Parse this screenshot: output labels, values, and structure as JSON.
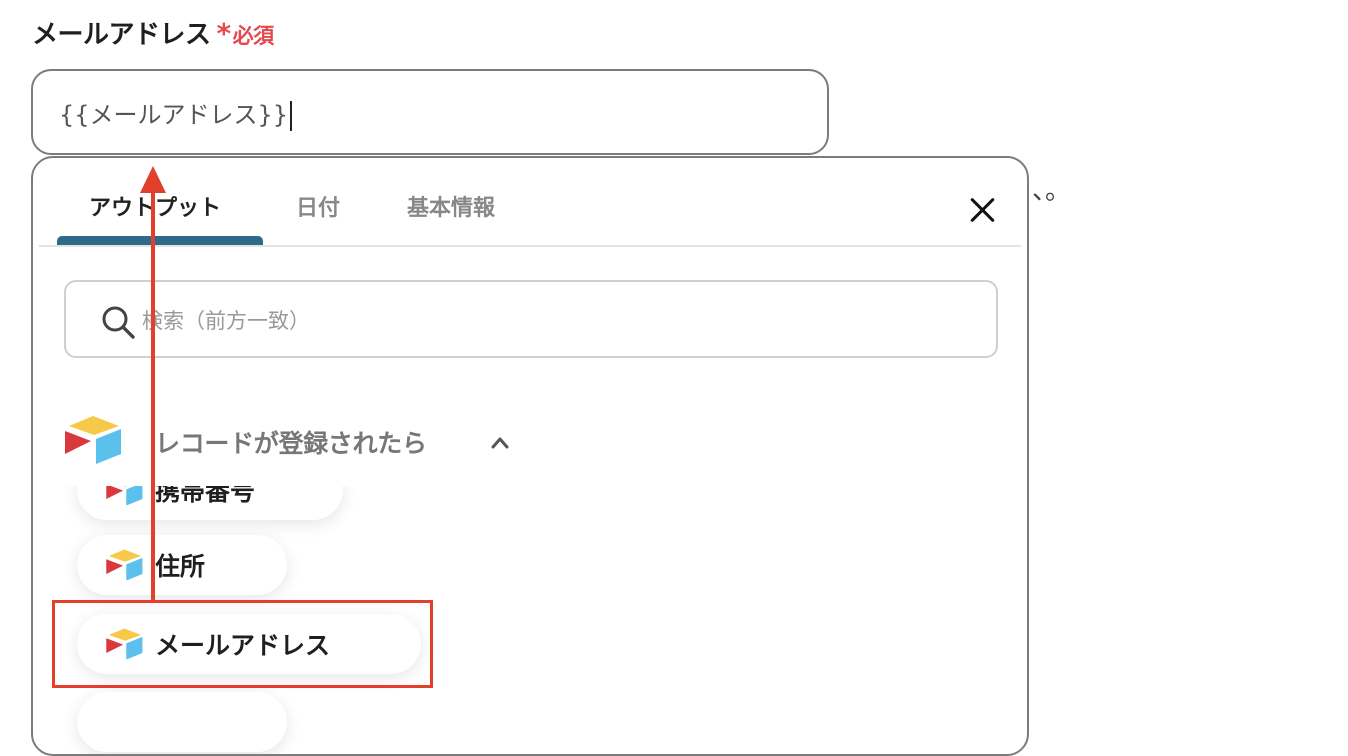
{
  "field": {
    "label": "メールアドレス",
    "required_star": "*",
    "required_text": "必須",
    "value": "{{メールアドレス}}"
  },
  "stray_mark": "、。",
  "panel": {
    "tabs": [
      {
        "label": "アウトプット",
        "active": true
      },
      {
        "label": "日付",
        "active": false
      },
      {
        "label": "基本情報",
        "active": false
      }
    ],
    "search": {
      "placeholder": "検索（前方一致）",
      "value": ""
    },
    "group": {
      "title": "レコードが登録されたら",
      "expanded": true
    },
    "items": [
      {
        "label": "携帯番号"
      },
      {
        "label": "住所"
      },
      {
        "label": "メールアドレス"
      },
      {
        "label": ""
      }
    ]
  },
  "colors": {
    "accent": "#2e6b8a",
    "required": "#e5484d",
    "annotation": "#e2402b",
    "logo_yellow": "#f7c948",
    "logo_blue": "#5bc0eb",
    "logo_red": "#d9383c"
  },
  "icons": {
    "search": "search-icon",
    "close": "close-icon",
    "chevron": "chevron-up-icon",
    "logo": "airtable-logo-icon"
  }
}
